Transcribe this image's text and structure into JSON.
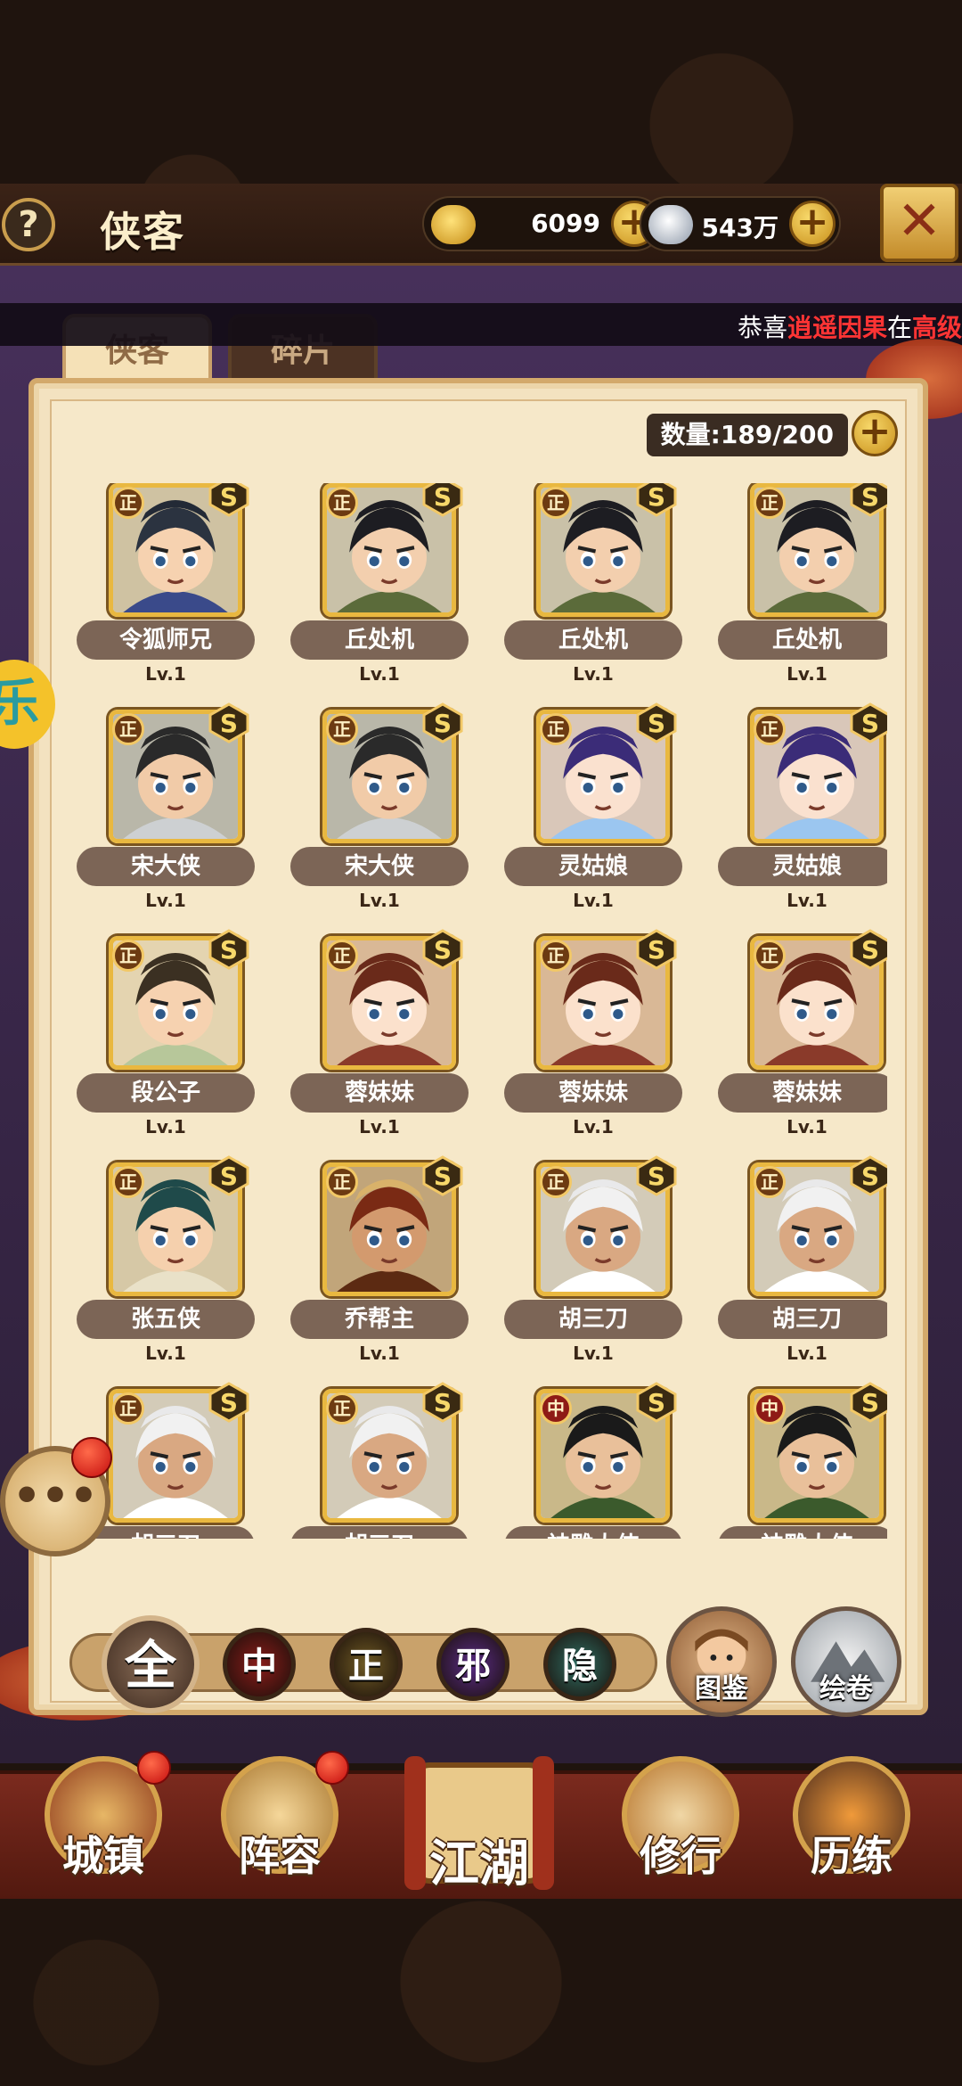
{
  "header": {
    "help_symbol": "?",
    "title": "侠客",
    "gold": {
      "icon": "gold-ingot-icon",
      "value": "6099"
    },
    "silver": {
      "icon": "silver-ingot-icon",
      "value": "543万"
    },
    "plus_symbol": "+",
    "close_icon": "crossed-swords-close-icon"
  },
  "ticker": {
    "prefix": "恭喜",
    "highlight1": "逍遥因果",
    "middle": "在",
    "highlight2": "高级"
  },
  "tabs": [
    {
      "label": "侠客",
      "active": true
    },
    {
      "label": "碎片",
      "active": false
    }
  ],
  "count": {
    "text": "数量:189/200"
  },
  "heroes": [
    {
      "name": "令狐师兄",
      "level": "Lv.1",
      "faction": "正",
      "rank": "S",
      "style": "scholar"
    },
    {
      "name": "丘处机",
      "level": "Lv.1",
      "faction": "正",
      "rank": "S",
      "style": "taoist"
    },
    {
      "name": "丘处机",
      "level": "Lv.1",
      "faction": "正",
      "rank": "S",
      "style": "taoist"
    },
    {
      "name": "丘处机",
      "level": "Lv.1",
      "faction": "正",
      "rank": "S",
      "style": "taoist"
    },
    {
      "name": "宋大侠",
      "level": "Lv.1",
      "faction": "正",
      "rank": "S",
      "style": "elder"
    },
    {
      "name": "宋大侠",
      "level": "Lv.1",
      "faction": "正",
      "rank": "S",
      "style": "elder"
    },
    {
      "name": "灵姑娘",
      "level": "Lv.1",
      "faction": "正",
      "rank": "S",
      "style": "maiden"
    },
    {
      "name": "灵姑娘",
      "level": "Lv.1",
      "faction": "正",
      "rank": "S",
      "style": "maiden"
    },
    {
      "name": "段公子",
      "level": "Lv.1",
      "faction": "正",
      "rank": "S",
      "style": "prince"
    },
    {
      "name": "蓉妹妹",
      "level": "Lv.1",
      "faction": "正",
      "rank": "S",
      "style": "girl"
    },
    {
      "name": "蓉妹妹",
      "level": "Lv.1",
      "faction": "正",
      "rank": "S",
      "style": "girl"
    },
    {
      "name": "蓉妹妹",
      "level": "Lv.1",
      "faction": "正",
      "rank": "S",
      "style": "girl"
    },
    {
      "name": "张五侠",
      "level": "Lv.1",
      "faction": "正",
      "rank": "S",
      "style": "swordsman"
    },
    {
      "name": "乔帮主",
      "level": "Lv.1",
      "faction": "正",
      "rank": "S",
      "style": "warrior"
    },
    {
      "name": "胡三刀",
      "level": "Lv.1",
      "faction": "正",
      "rank": "S",
      "style": "fur"
    },
    {
      "name": "胡三刀",
      "level": "Lv.1",
      "faction": "正",
      "rank": "S",
      "style": "fur"
    },
    {
      "name": "胡三刀",
      "level": "",
      "faction": "正",
      "rank": "S",
      "style": "fur"
    },
    {
      "name": "胡三刀",
      "level": "",
      "faction": "正",
      "rank": "S",
      "style": "fur"
    },
    {
      "name": "神雕大侠",
      "level": "",
      "faction": "中",
      "rank": "S",
      "style": "hero"
    },
    {
      "name": "神雕大侠",
      "level": "",
      "faction": "中",
      "rank": "S",
      "style": "hero"
    }
  ],
  "filters": [
    {
      "label": "全",
      "color": "#6b5443"
    },
    {
      "label": "中",
      "color": "#8a1c1a"
    },
    {
      "label": "正",
      "color": "#6f5a24"
    },
    {
      "label": "邪",
      "color": "#5a2c86"
    },
    {
      "label": "隐",
      "color": "#2f6e63"
    }
  ],
  "side_buttons": [
    {
      "label": "图鉴"
    },
    {
      "label": "绘卷"
    }
  ],
  "chat": {
    "symbol": "•••"
  },
  "side_tag": {
    "text": "乐"
  },
  "nav": [
    {
      "label": "城镇"
    },
    {
      "label": "阵容"
    },
    {
      "label": "江湖"
    },
    {
      "label": "修行"
    },
    {
      "label": "历练"
    }
  ]
}
